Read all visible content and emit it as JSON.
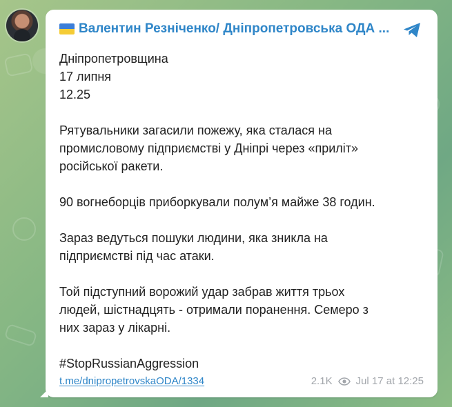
{
  "colors": {
    "accent": "#2f86c8",
    "text": "#222222",
    "meta": "#a2a6ab",
    "bubble": "#ffffff"
  },
  "icons": {
    "avatar": "avatar",
    "flag": "ukraine-flag-icon",
    "share": "telegram-share-icon",
    "views": "eye-icon"
  },
  "post": {
    "channel_name": "Валентин Резніченко/ Дніпропетровська ОДА ...",
    "lines": [
      "Дніпропетровщина",
      "17 липня",
      "12.25",
      "",
      "Рятувальники загасили пожежу, яка сталася на",
      "промисловому підприємстві у Дніпрі через «приліт»",
      "російської ракети.",
      "",
      "90 вогнеборців приборкували полум’я майже 38 годин.",
      "",
      "Зараз ведуться пошуки людини, яка зникла на",
      "підприємстві під час атаки.",
      "",
      "Той підступний ворожий удар забрав життя трьох",
      "людей, шістнадцять - отримали поранення. Семеро з",
      "них зараз у лікарні.",
      "",
      "#StopRussianAggression"
    ],
    "link": "t.me/dnipropetrovskaODA/1334",
    "views": "2.1K",
    "timestamp": "Jul 17 at 12:25"
  }
}
